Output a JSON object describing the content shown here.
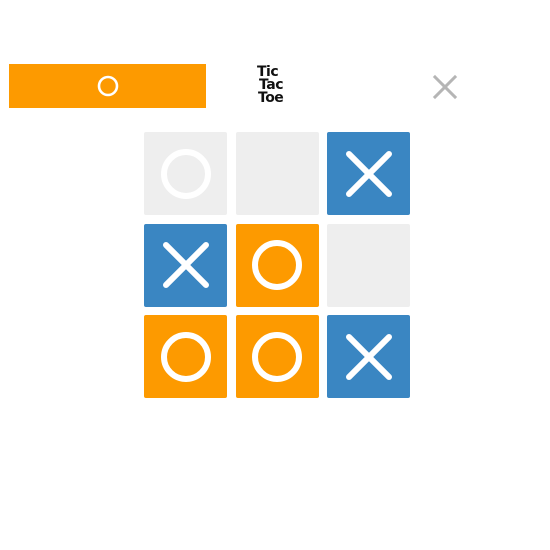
{
  "colors": {
    "x_cell": "#3a86c2",
    "o_cell": "#fd9a00",
    "empty_cell": "#eeeeee",
    "mark_on_colored": "#ffffff",
    "turn_bar": "#fd9a00",
    "close_icon": "#b5b5b5"
  },
  "header": {
    "turn_indicator": {
      "current_player": "O",
      "icon": "o-mark-icon"
    },
    "logo": {
      "line1": "Tic",
      "line2": "Tac",
      "line3": "Toe"
    },
    "close_icon": "close-icon"
  },
  "board": {
    "rows": 3,
    "cols": 3,
    "cells": [
      {
        "mark": "O",
        "highlighted": false
      },
      {
        "mark": "",
        "highlighted": false
      },
      {
        "mark": "X",
        "highlighted": true
      },
      {
        "mark": "X",
        "highlighted": true
      },
      {
        "mark": "O",
        "highlighted": true
      },
      {
        "mark": "",
        "highlighted": false
      },
      {
        "mark": "O",
        "highlighted": true
      },
      {
        "mark": "O",
        "highlighted": true
      },
      {
        "mark": "X",
        "highlighted": true
      }
    ]
  }
}
